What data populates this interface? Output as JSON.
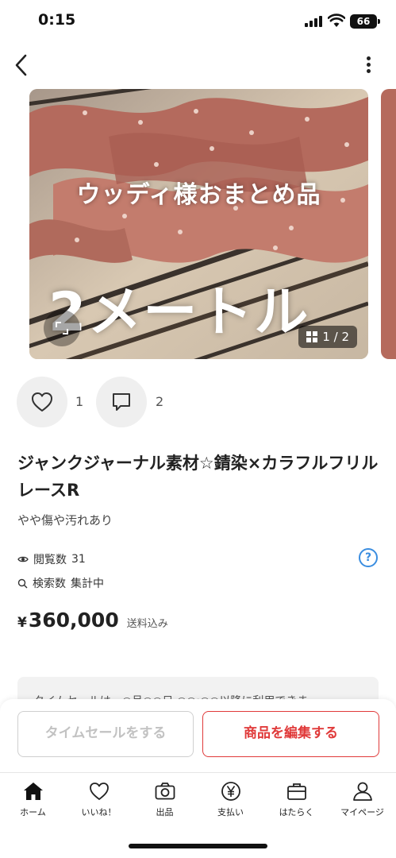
{
  "status_bar": {
    "time": "0:15",
    "battery": "66"
  },
  "photo": {
    "caption_line1": "ウッディ様おまとめ品",
    "caption_line2": "2メートル",
    "counter": "1 / 2"
  },
  "actions": {
    "like_count": "1",
    "comment_count": "2"
  },
  "item": {
    "title": "ジャンクジャーナル素材☆錆染×カラフルフリルレースR",
    "condition": "やや傷や汚れあり"
  },
  "stats": {
    "views_label": "閲覧数",
    "views_value": "31",
    "search_label": "検索数",
    "search_value": "集計中"
  },
  "price": {
    "currency": "¥",
    "value": "360,000",
    "note": "送料込み"
  },
  "notice": {
    "text": "タイムセールは一○月○○日 ○○:○○以降に利用できま"
  },
  "buttons": {
    "timesale": "タイムセールをする",
    "edit": "商品を編集する"
  },
  "tab_bar": {
    "items": [
      {
        "label": "ホーム",
        "icon": "home-icon"
      },
      {
        "label": "いいね！",
        "icon": "heart-icon"
      },
      {
        "label": "出品",
        "icon": "camera-icon"
      },
      {
        "label": "支払い",
        "icon": "yen-icon"
      },
      {
        "label": "はたらく",
        "icon": "briefcase-icon"
      },
      {
        "label": "マイページ",
        "icon": "person-icon"
      }
    ]
  },
  "colors": {
    "accent": "#e03a3a",
    "help_blue": "#3a8de0"
  }
}
